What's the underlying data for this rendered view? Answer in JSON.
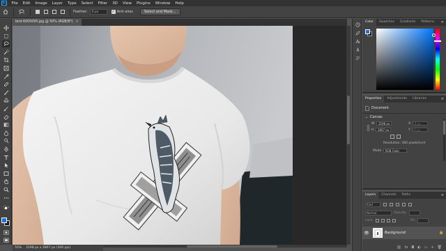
{
  "menu": {
    "logo": "Ps",
    "items": [
      "File",
      "Edit",
      "Image",
      "Layer",
      "Type",
      "Select",
      "Filter",
      "3D",
      "View",
      "Plugins",
      "Window",
      "Help"
    ]
  },
  "options": {
    "feather_label": "Feather:",
    "feather_value": "0 px",
    "anti_alias_label": "Anti-alias",
    "select_mask_label": "Select and Mask..."
  },
  "document": {
    "tab_title": "bird-6005095.jpg @ 50% (RGB/8*)",
    "tab_close": "×"
  },
  "status": {
    "zoom": "50%",
    "doc_size": "3198 px x 2867 px (300 ppi)"
  },
  "color_panel": {
    "tabs": [
      "Color",
      "Swatches",
      "Gradients",
      "Patterns"
    ],
    "foreground": "#1f6ee8",
    "background": "#1a1a1a"
  },
  "properties_panel": {
    "tabs": [
      "Properties",
      "Adjustments",
      "Libraries"
    ],
    "doc_label": "Document",
    "canvas_label": "Canvas",
    "width_label": "W",
    "width_value": "3198 px",
    "height_label": "H",
    "height_value": "2867 px",
    "x_label": "X",
    "x_value": "0 px",
    "y_label": "Y",
    "y_value": "0 px",
    "resolution": "Resolution: 300 pixels/inch",
    "mode_label": "Mode",
    "mode_value": "RGB Color"
  },
  "layers_panel": {
    "tabs": [
      "Layers",
      "Channels",
      "Paths"
    ],
    "kind_label": "Kind",
    "blend_label": "Normal",
    "opacity_label": "Opacity:",
    "lock_label": "Lock:",
    "fill_label": "Fill:",
    "layer_name": "Background"
  }
}
